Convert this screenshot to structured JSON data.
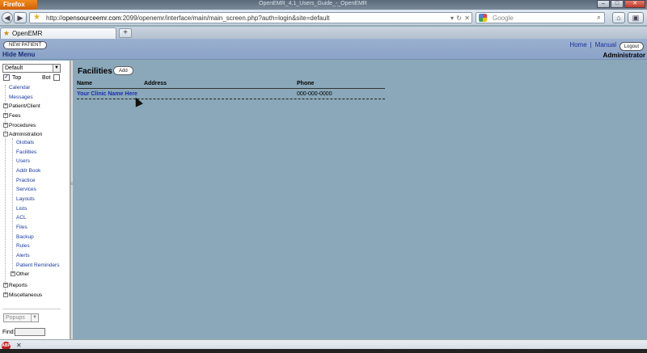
{
  "browser": {
    "menu_button": "Firefox",
    "window_title": "OpenEMR_4.1_Users_Guide_-_OpenEMR",
    "url_host": "opensourceemr.com",
    "url_rest": ":2099/openemr/interface/main/main_screen.php?auth=login&site=default",
    "url_prefix": "http://",
    "search_placeholder": "Google",
    "tab_label": "OpenEMR",
    "new_tab_symbol": "+",
    "window_controls": [
      "–",
      "□",
      "✕"
    ]
  },
  "header": {
    "new_patient_label": "NEW PATIENT",
    "hide_menu_label": "Hide Menu",
    "home_link": "Home",
    "separator": "|",
    "manual_link": "Manual",
    "logout_label": "Logout",
    "user_label": "Administrator"
  },
  "leftmenu": {
    "select_value": "Default",
    "top_label": "Top",
    "bot_label": "Bot",
    "items": {
      "calendar": "Calendar",
      "messages": "Messages",
      "patient_client": "Patient/Client",
      "fees": "Fees",
      "procedures": "Procedures",
      "administration": "Administration",
      "globals": "Globals",
      "facilities": "Facilities",
      "users": "Users",
      "addr_book": "Addr Book",
      "practice": "Practice",
      "services": "Services",
      "layouts": "Layouts",
      "lists": "Lists",
      "acl": "ACL",
      "files": "Files",
      "backup": "Backup",
      "rules": "Rules",
      "alerts": "Alerts",
      "patient_reminders": "Patient Reminders",
      "other": "Other",
      "reports": "Reports",
      "miscellaneous": "Miscellaneous"
    },
    "popups_label": "Popups",
    "find_label": "Find:"
  },
  "main": {
    "title": "Facilities",
    "add_label": "Add",
    "columns": {
      "name": "Name",
      "address": "Address",
      "phone": "Phone"
    },
    "rows": [
      {
        "name": "Your Clinic Name Here",
        "address": "",
        "phone": "000-000-0000"
      }
    ]
  },
  "addonbar": {
    "abp_label": "ABP",
    "close_symbol": "✕"
  }
}
